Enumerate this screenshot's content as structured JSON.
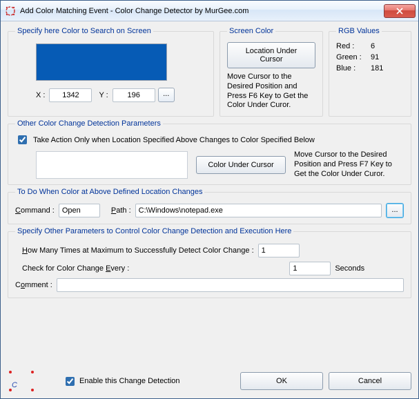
{
  "window": {
    "title": "Add Color Matching Event - Color Change Detector by MurGee.com"
  },
  "search": {
    "legend": "Specify here Color to Search on Screen",
    "swatch_color": "#065bb5",
    "x_label": "X :",
    "x_value": "1342",
    "y_label": "Y :",
    "y_value": "196",
    "browse_label": "..."
  },
  "screen_color": {
    "legend": "Screen Color",
    "button": "Location Under Cursor",
    "note": "Move Cursor to the Desired Position and Press  F6  Key to Get the Color Under Curor."
  },
  "rgb": {
    "legend": "RGB Values",
    "red_label": "Red :",
    "red_value": "6",
    "green_label": "Green :",
    "green_value": "91",
    "blue_label": "Blue :",
    "blue_value": "181"
  },
  "other": {
    "legend": "Other Color Change Detection Parameters",
    "checkbox_label": "Take Action Only when Location Specified Above Changes to  Color Specified Below",
    "checkbox_checked": true,
    "swatch_color": "#ffffff",
    "button": "Color Under Cursor",
    "note": "Move Cursor to the Desired Position and Press  F7  Key to Get the Color Under Curor."
  },
  "todo": {
    "legend": "To Do When Color at Above Defined Location Changes",
    "command_label": "Command :",
    "command_value": "Open",
    "path_label": "Path :",
    "path_value": "C:\\Windows\\notepad.exe",
    "browse_label": "..."
  },
  "params": {
    "legend": "Specify Other Parameters to Control Color Change Detection and Execution Here",
    "max_label_pre": "How Many Times at Maximum to Successfully Detect Color Change :",
    "max_value": "1",
    "every_label": "Check for Color Change Every :",
    "every_value": "1",
    "every_unit": "Seconds",
    "comment_label": "Comment :",
    "comment_value": ""
  },
  "footer": {
    "enable_label": "Enable this Change Detection",
    "enable_checked": true,
    "ok": "OK",
    "cancel": "Cancel"
  }
}
